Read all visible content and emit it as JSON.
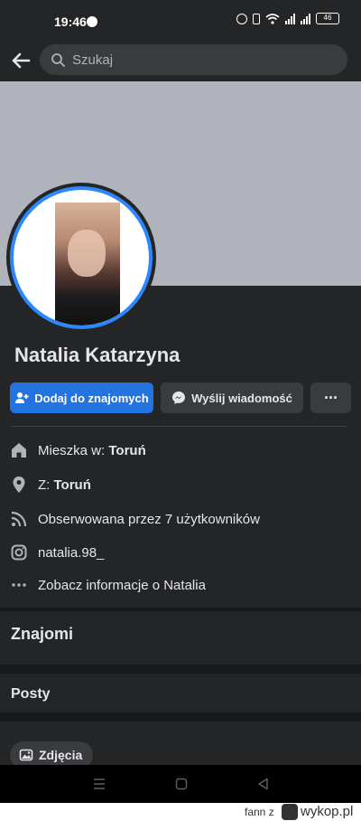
{
  "status_bar": {
    "time": "19:46",
    "battery": "46"
  },
  "search": {
    "placeholder": "Szukaj"
  },
  "profile": {
    "name": "Natalia Katarzyna"
  },
  "actions": {
    "add_friend": "Dodaj do znajomych",
    "message": "Wyślij wiadomość",
    "more": "···"
  },
  "info": {
    "lives_label": "Mieszka w: ",
    "lives_value": "Toruń",
    "from_label": "Z: ",
    "from_value": "Toruń",
    "followers": "Obserwowana przez 7 użytkowników",
    "instagram": "natalia.98_",
    "see_more": "Zobacz informacje o Natalia"
  },
  "sections": {
    "friends": "Znajomi",
    "posts": "Posty"
  },
  "photos_chip": "Zdjęcia",
  "watermark": {
    "user": "fann",
    "separator": "z",
    "site": "wykop.pl"
  },
  "colors": {
    "accent": "#2374e1",
    "ring": "#2d88ff",
    "bg": "#242526",
    "cover": "#b0b3bb"
  },
  "icons": [
    "messenger-icon",
    "alarm-icon",
    "vibrate-icon",
    "wifi-icon",
    "signal-icon",
    "battery-icon",
    "back-arrow-icon",
    "search-icon",
    "add-friend-icon",
    "messenger-icon",
    "more-icon",
    "home-icon",
    "location-pin-icon",
    "rss-icon",
    "instagram-icon",
    "dots-icon",
    "image-icon",
    "menu-icon",
    "square-icon",
    "triangle-back-icon"
  ]
}
